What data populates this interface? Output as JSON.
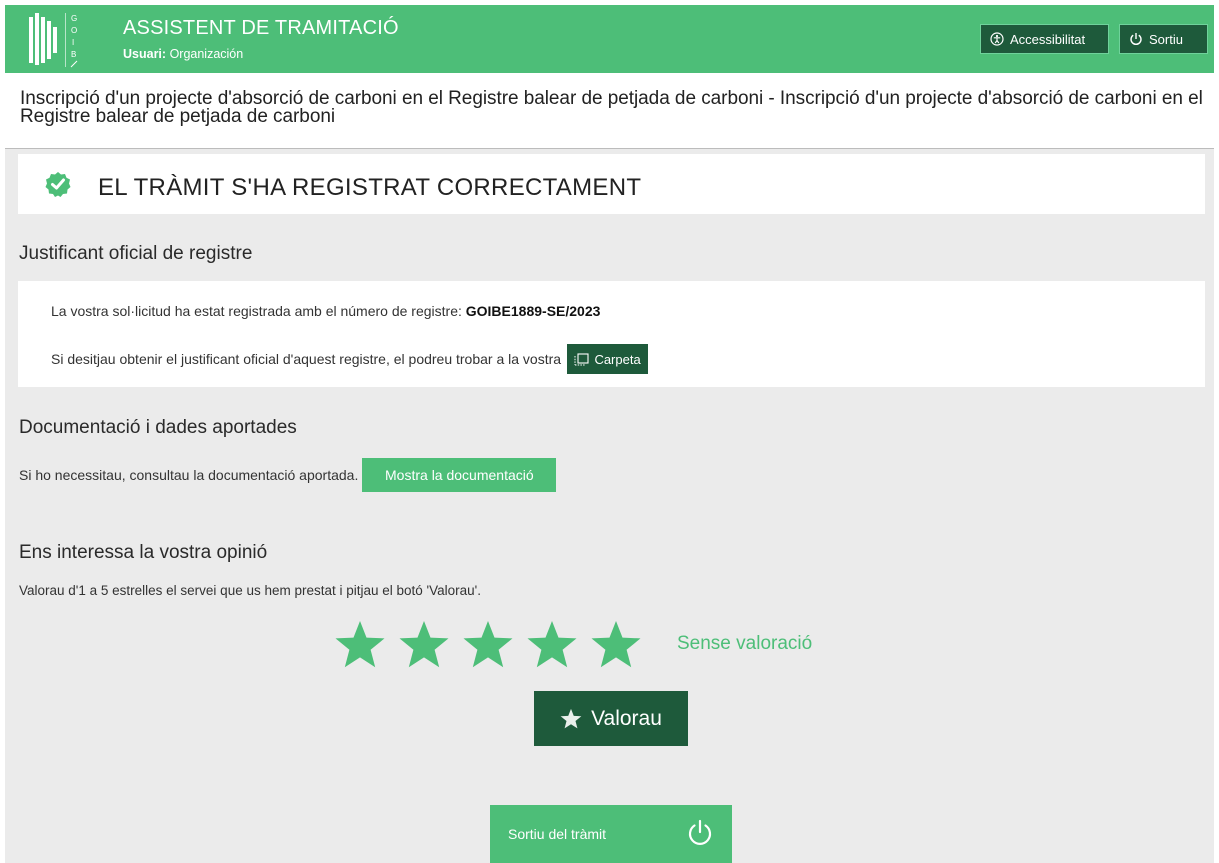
{
  "header": {
    "logo_letters": "GOIB",
    "title": "ASSISTENT DE TRAMITACIÓ",
    "user_label": "Usuari:",
    "user_name": "Organización",
    "accessibility_label": "Accessibilitat",
    "exit_label": "Sortiu"
  },
  "procedure": {
    "title": "Inscripció d'un projecte d'absorció de carboni en el Registre balear de petjada de carboni - Inscripció d'un projecte d'absorció de carboni en el Registre balear de petjada de carboni"
  },
  "success": {
    "message": "EL TRÀMIT S'HA REGISTRAT CORRECTAMENT"
  },
  "registry": {
    "heading": "Justificant oficial de registre",
    "line1_prefix": "La vostra sol·licitud ha estat registrada amb el número de registre:",
    "number": "GOIBE1889-SE/2023",
    "line2_prefix": "Si desitjau obtenir el justificant oficial d'aquest registre, el podreu trobar a la vostra",
    "carpeta_label": "Carpeta"
  },
  "documentation": {
    "heading": "Documentació i dades aportades",
    "text": "Si ho necessitau, consultau la documentació aportada.",
    "button_label": "Mostra la documentació"
  },
  "rating": {
    "heading": "Ens interessa la vostra opinió",
    "instructions": "Valorau d'1 a 5 estrelles el servei que us hem prestat i pitjau el botó 'Valorau'.",
    "max_stars": 5,
    "status": "Sense valoració",
    "button_label": "Valorau"
  },
  "footer": {
    "exit_button_label": "Sortiu del tràmit"
  },
  "colors": {
    "brand_green": "#4dbe78",
    "dark_green": "#1e5a3b",
    "panel_bg": "#ebebeb"
  },
  "icons": {
    "accessibility": "accessibility-icon",
    "power": "power-icon",
    "success": "check-badge-icon",
    "carpeta": "folder-icon",
    "star": "star-icon"
  }
}
